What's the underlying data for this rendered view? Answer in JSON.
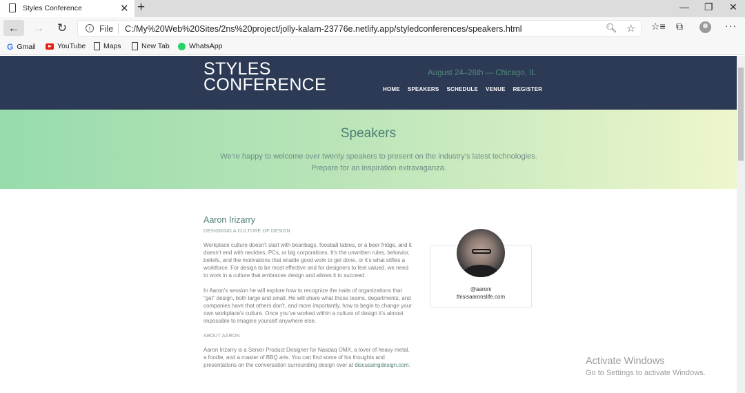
{
  "browser": {
    "tab_title": "Styles Conference",
    "new_tab": "+",
    "url_scheme": "File",
    "url": "C:/My%20Web%20Sites/2ns%20project/jolly-kalam-23776e.netlify.app/styledconferences/speakers.html",
    "bookmarks": [
      "Gmail",
      "YouTube",
      "Maps",
      "New Tab",
      "WhatsApp"
    ]
  },
  "header": {
    "logo_line1": "STYLES",
    "logo_line2": "CONFERENCE",
    "tagline": "August 24–26th — Chicago, IL",
    "nav": [
      "HOME",
      "SPEAKERS",
      "SCHEDULE",
      "VENUE",
      "REGISTER"
    ]
  },
  "hero": {
    "title": "Speakers",
    "subtitle_line1": "We’re happy to welcome over twenty speakers to present on the industry’s latest technologies.",
    "subtitle_line2": "Prepare for an inspiration extravaganza."
  },
  "speaker": {
    "name": "Aaron Irizarry",
    "talk": "DESIGNING A CULTURE OF DESIGN",
    "para1": "Workplace culture doesn’t start with beanbags, foosball tables, or a beer fridge, and it doesn’t end with neckties, PCs, or big corporations. It’s the unwritten rules, behavior, beliefs, and the motivations that enable good work to get done, or it’s what stifles a workforce. For design to be most effective and for designers to feel valued, we need to work in a culture that embraces design and allows it to succeed.",
    "para2": "In Aaron’s session he will explore how to recognize the traits of organizations that “get” design, both large and small. He will share what those teams, departments, and companies have that others don’t, and more importantly, how to begin to change your own workplace’s culture. Once you’ve worked within a culture of design it’s almost impossible to imagine yourself anywhere else.",
    "about_heading": "ABOUT AARON",
    "about_text": "Aaron Irizarry is a Senior Product Designer for Nasdaq OMX, a lover of heavy metal, a foodie, and a master of BBQ arts. You can find some of his thoughts and presentations on the conversation surrounding design over at",
    "about_link": "discussingdesign.com",
    "about_end": ".",
    "handle": "@aaroni",
    "website": "thisisaaronslife.com"
  },
  "watermark": {
    "line1": "Activate Windows",
    "line2": "Go to Settings to activate Windows."
  }
}
